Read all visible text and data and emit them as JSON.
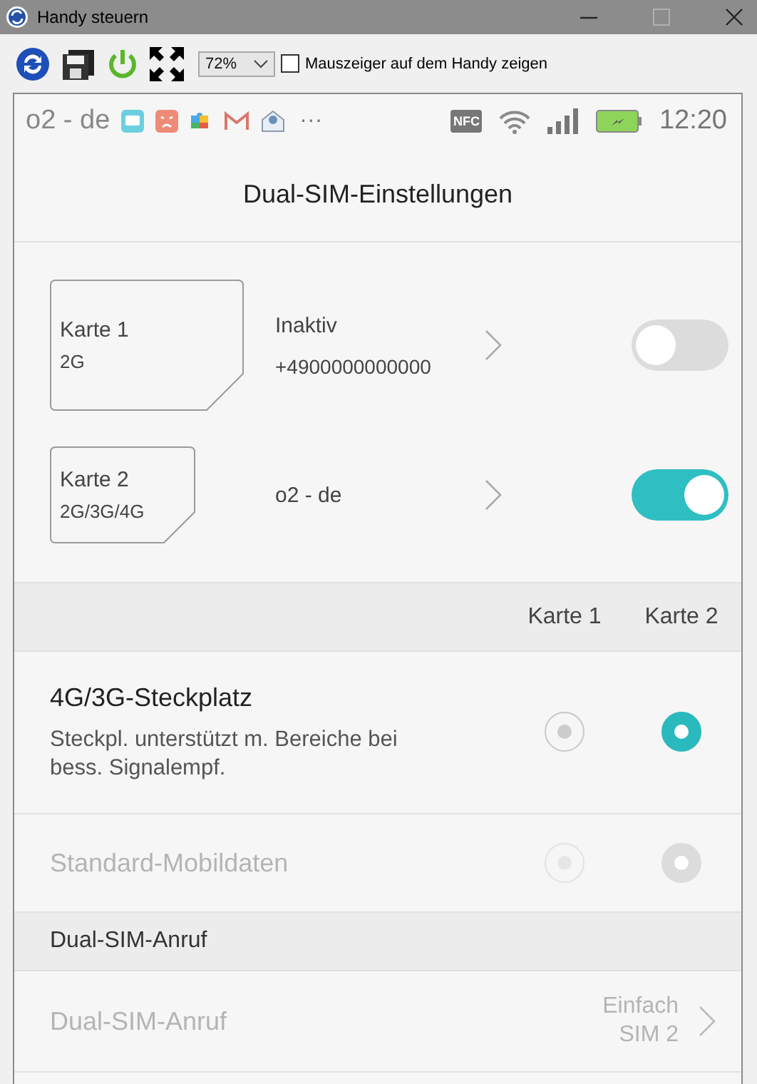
{
  "window": {
    "title": "Handy steuern"
  },
  "toolbar": {
    "zoom": "72%",
    "pointer_checkbox": {
      "label": "Mauszeiger auf dem Handy zeigen",
      "checked": false
    }
  },
  "status_bar": {
    "carrier": "o2 - de",
    "more": "···",
    "nfc": "NFC",
    "time": "12:20"
  },
  "header": {
    "title": "Dual-SIM-Einstellungen"
  },
  "sim_cards": [
    {
      "name": "Karte 1",
      "network": "2G",
      "kind": "large",
      "status": "Inaktiv",
      "number": "+4900000000000",
      "on": false
    },
    {
      "name": "Karte 2",
      "network": "2G/3G/4G",
      "kind": "small",
      "status": "o2 - de",
      "on": true
    }
  ],
  "column_labels": [
    "Karte 1",
    "Karte 2"
  ],
  "options": [
    {
      "title": "4G/3G-Steckplatz",
      "description": "Steckpl. unterstützt m. Bereiche bei bess. Signalempf.",
      "disabled": false,
      "choices": [
        {
          "selected": false
        },
        {
          "selected": true
        }
      ]
    },
    {
      "title": "Standard-Mobildaten",
      "disabled": true,
      "choices": [
        {
          "selected": false
        },
        {
          "selected": true
        }
      ]
    }
  ],
  "call_section": {
    "heading": "Dual-SIM-Anruf",
    "rows": [
      {
        "title": "Dual-SIM-Anruf",
        "value": "Einfach SIM 2",
        "disabled": true
      }
    ]
  }
}
